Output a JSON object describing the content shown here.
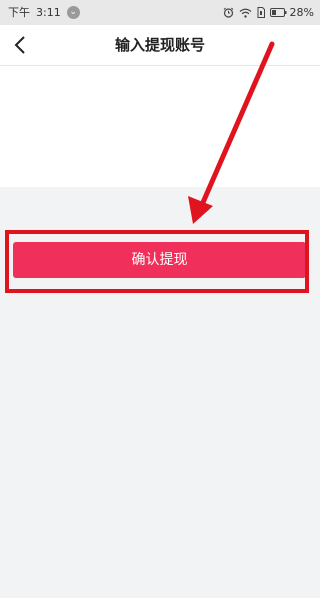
{
  "status_bar": {
    "period": "下午",
    "time": "3:11",
    "battery": "28%",
    "icons": [
      "download-icon",
      "alarm-icon",
      "wifi-icon",
      "sim-icon",
      "battery-icon"
    ]
  },
  "header": {
    "title": "输入提现账号",
    "back_icon": "chevron-left-icon"
  },
  "main": {
    "confirm_button_label": "确认提现"
  },
  "annotation": {
    "color": "#e0141e"
  },
  "colors": {
    "button": "#f0305a",
    "background": "#f2f3f5"
  }
}
